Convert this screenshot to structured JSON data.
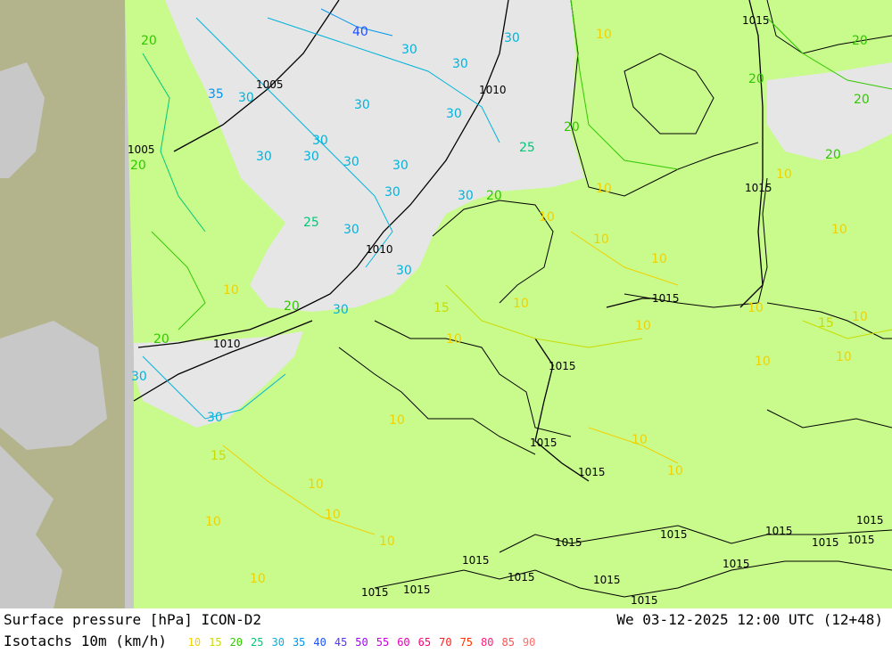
{
  "footer": {
    "left_title": "Surface pressure [hPa] ICON-D2",
    "timestamp": "We 03-12-2025 12:00 UTC (12+48)",
    "isotachs_label": "Isotachs 10m (km/h)",
    "legend": [
      {
        "value": "10",
        "color": "#f0d200"
      },
      {
        "value": "15",
        "color": "#c8dc00"
      },
      {
        "value": "20",
        "color": "#32c800"
      },
      {
        "value": "25",
        "color": "#00c878"
      },
      {
        "value": "30",
        "color": "#00b4dc"
      },
      {
        "value": "35",
        "color": "#0096f0"
      },
      {
        "value": "40",
        "color": "#1e50ff"
      },
      {
        "value": "45",
        "color": "#5a32ff"
      },
      {
        "value": "50",
        "color": "#a000ff"
      },
      {
        "value": "55",
        "color": "#c800dc"
      },
      {
        "value": "60",
        "color": "#e600b4"
      },
      {
        "value": "65",
        "color": "#ff0078"
      },
      {
        "value": "70",
        "color": "#ff1e1e"
      },
      {
        "value": "75",
        "color": "#ff3200"
      },
      {
        "value": "80",
        "color": "#ff1e78"
      },
      {
        "value": "85",
        "color": "#ff5050"
      },
      {
        "value": "90",
        "color": "#ff6e6e"
      }
    ]
  },
  "colors": {
    "land_in_domain": "#c8fa8c",
    "land_outside": "#b4b48c",
    "sea_outside": "#c8c8c8",
    "sea_in_domain": "#e6e6e6",
    "pressure_line": "#000000"
  },
  "pressure_labels": [
    "1005",
    "1010",
    "1005",
    "1010",
    "1010",
    "1015",
    "1015",
    "1015",
    "1015",
    "1015",
    "1015",
    "1015",
    "1015",
    "1015",
    "1015",
    "1015",
    "1015",
    "1015",
    "1015",
    "1015",
    "1015",
    "1015",
    "1015",
    "1015"
  ],
  "isotach_labels": [
    "40",
    "30",
    "30",
    "30",
    "35",
    "30",
    "30",
    "30",
    "30",
    "30",
    "30",
    "30",
    "25",
    "30",
    "30",
    "30",
    "30",
    "25",
    "30",
    "30",
    "30",
    "30",
    "20",
    "20",
    "20",
    "20",
    "10",
    "10",
    "10",
    "10",
    "10",
    "10",
    "10",
    "15",
    "10",
    "10",
    "10",
    "10",
    "10",
    "10",
    "20",
    "10",
    "10",
    "10",
    "10",
    "15",
    "10",
    "10",
    "20",
    "20",
    "20",
    "20",
    "15",
    "20",
    "10",
    "10",
    "10",
    "10"
  ]
}
